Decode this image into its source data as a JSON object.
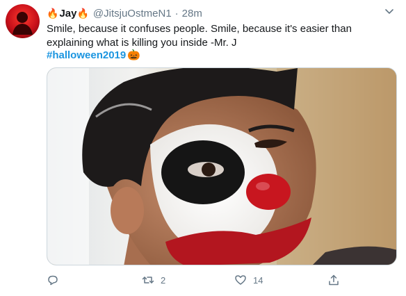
{
  "tweet": {
    "author": {
      "name_prefix_emoji": "🔥",
      "name": "Jay",
      "name_suffix_emoji": "🔥",
      "handle": "@JitsjuOstmeN1"
    },
    "separator": "·",
    "time": "28m",
    "text": "Smile, because it confuses people. Smile, because it's easier than explaining what is killing you inside -Mr. J",
    "hashtag": "#halloween2019",
    "hashtag_emoji": "🎃",
    "media_description": "Selfie with clown face paint",
    "actions": {
      "reply_count": "",
      "retweet_count": "2",
      "like_count": "14"
    },
    "colors": {
      "link": "#1b95e0",
      "muted": "#657786",
      "text": "#14171a"
    }
  }
}
